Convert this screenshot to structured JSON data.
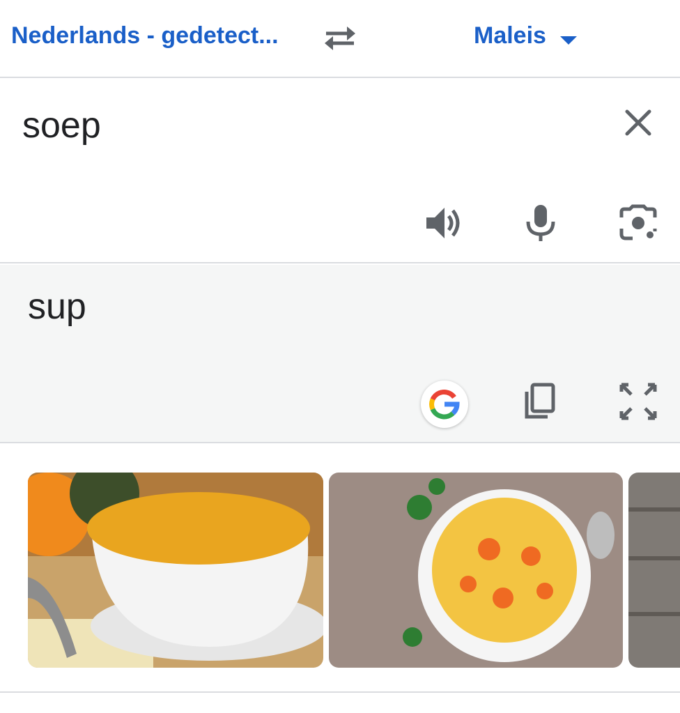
{
  "language_bar": {
    "source_language": "Nederlands - gedetect...",
    "target_language": "Maleis",
    "swap_icon": "swap-arrows-icon",
    "dropdown_icon": "caret-down-icon",
    "link_color": "#1a5fc8"
  },
  "input": {
    "text": "soep",
    "actions": [
      "clear-icon",
      "speaker-icon",
      "microphone-icon",
      "camera-icon"
    ]
  },
  "output": {
    "text": "sup",
    "actions": [
      "google-g-icon",
      "copy-icon",
      "fullscreen-icon"
    ],
    "background_color": "#f5f6f6"
  },
  "images": {
    "items": [
      {
        "name": "pumpkin-soup-image"
      },
      {
        "name": "chicken-noodle-soup-image"
      },
      {
        "name": "wooden-table-image"
      }
    ]
  }
}
